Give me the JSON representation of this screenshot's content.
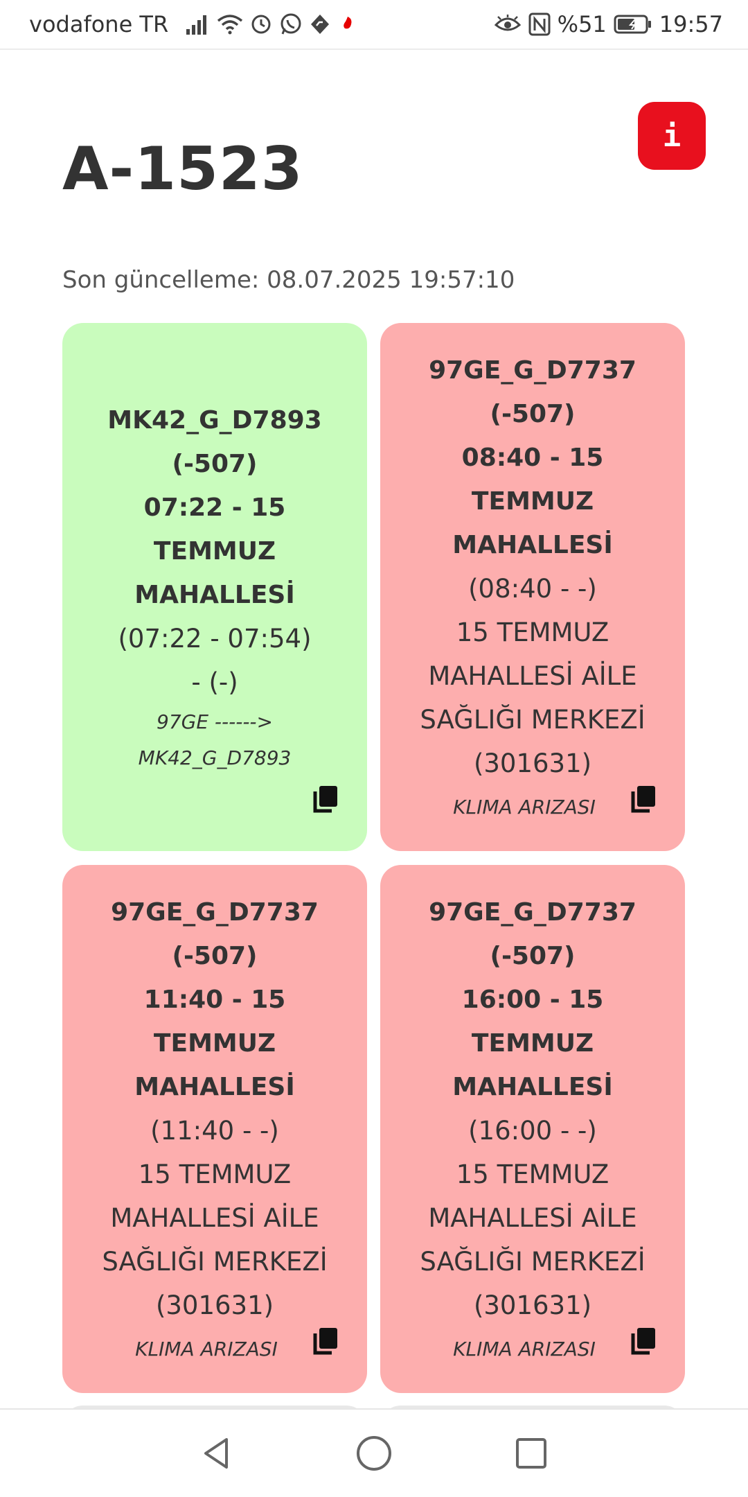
{
  "status_bar": {
    "carrier": "vodafone TR",
    "battery": "%51",
    "time": "19:57"
  },
  "page": {
    "title": "A-1523",
    "info_label": "i",
    "last_update": "Son güncelleme: 08.07.2025 19:57:10"
  },
  "cards": [
    {
      "color": "#c9fcbd",
      "bold_lines": [
        "MK42_G_D7893",
        "(-507)",
        "07:22 - 15",
        "TEMMUZ",
        "MAHALLESİ"
      ],
      "lines": [
        "(07:22 - 07:54)",
        "- (-)"
      ],
      "note_lines": [
        "97GE ------>",
        "MK42_G_D7893"
      ]
    },
    {
      "color": "#fdaeae",
      "bold_lines": [
        "97GE_G_D7737",
        "(-507)",
        "08:40 - 15",
        "TEMMUZ",
        "MAHALLESİ"
      ],
      "lines": [
        "(08:40 - -)",
        "15 TEMMUZ",
        "MAHALLESİ AİLE",
        "SAĞLIĞI MERKEZİ",
        "(301631)"
      ],
      "note_lines": [
        "KLIMA ARIZASI"
      ]
    },
    {
      "color": "#fdaeae",
      "bold_lines": [
        "97GE_G_D7737",
        "(-507)",
        "11:40 - 15",
        "TEMMUZ",
        "MAHALLESİ"
      ],
      "lines": [
        "(11:40 - -)",
        "15 TEMMUZ",
        "MAHALLESİ AİLE",
        "SAĞLIĞI MERKEZİ",
        "(301631)"
      ],
      "note_lines": [
        "KLIMA ARIZASI"
      ]
    },
    {
      "color": "#fdaeae",
      "bold_lines": [
        "97GE_G_D7737",
        "(-507)",
        "16:00 - 15",
        "TEMMUZ",
        "MAHALLESİ"
      ],
      "lines": [
        "(16:00 - -)",
        "15 TEMMUZ",
        "MAHALLESİ AİLE",
        "SAĞLIĞI MERKEZİ",
        "(301631)"
      ],
      "note_lines": [
        "KLIMA ARIZASI"
      ]
    }
  ],
  "icons": {
    "info": "info-icon",
    "copy": "copy-icon",
    "back": "back-triangle-icon",
    "home": "home-circle-icon",
    "recents": "recents-square-icon"
  },
  "colors": {
    "info_button": "#e8101e",
    "green_card": "#c9fcbd",
    "red_card": "#fdaeae"
  }
}
